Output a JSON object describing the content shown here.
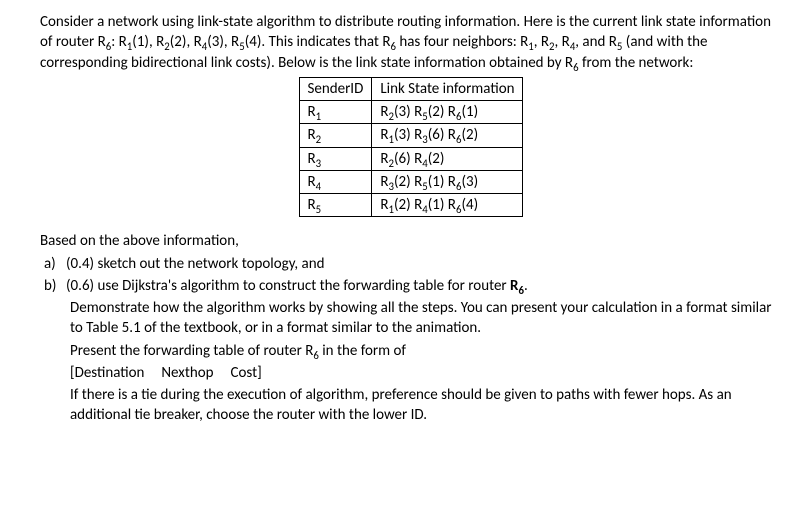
{
  "intro": {
    "line1_a": "Consider a network using link-state algorithm to distribute routing information. Here is the",
    "line2_a": "current link state information of router R",
    "line2_b": ": R",
    "line2_c": "(1), R",
    "line2_d": "(2), R",
    "line2_e": "(3), R",
    "line2_f": "(4). This indicates that R",
    "line2_g": " has",
    "line3_a": "four neighbors: R",
    "line3_b": ", R",
    "line3_c": ", R",
    "line3_d": ", and R",
    "line3_e": " (and with the corresponding bidirectional link costs). Below is",
    "line4_a": "the link state information obtained by R",
    "line4_b": " from the network:"
  },
  "table": {
    "headers": {
      "sender": "SenderID",
      "ls": "Link State information"
    },
    "rows": [
      {
        "sender_pre": "R",
        "sender_sub": "1",
        "ls_parts": [
          [
            "R",
            "2",
            "(3)  "
          ],
          [
            "R",
            "5",
            "(2)  "
          ],
          [
            "R",
            "6",
            "(1)"
          ]
        ]
      },
      {
        "sender_pre": "R",
        "sender_sub": "2",
        "ls_parts": [
          [
            "R",
            "1",
            "(3)  "
          ],
          [
            "R",
            "3",
            "(6)  "
          ],
          [
            "R",
            "6",
            "(2)"
          ]
        ]
      },
      {
        "sender_pre": "R",
        "sender_sub": "3",
        "ls_parts": [
          [
            "R",
            "2",
            "(6)  "
          ],
          [
            "R",
            "4",
            "(2)"
          ]
        ]
      },
      {
        "sender_pre": "R",
        "sender_sub": "4",
        "ls_parts": [
          [
            "R",
            "3",
            "(2)  "
          ],
          [
            "R",
            "5",
            "(1)  "
          ],
          [
            "R",
            "6",
            "(3)"
          ]
        ]
      },
      {
        "sender_pre": "R",
        "sender_sub": "5",
        "ls_parts": [
          [
            "R",
            "1",
            "(2)  "
          ],
          [
            "R",
            "4",
            "(1)  "
          ],
          [
            "R",
            "6",
            "(4)"
          ]
        ]
      }
    ]
  },
  "based": "Based on the above information,",
  "qa": {
    "label": "a)",
    "text": "(0.4) sketch out the network topology, and"
  },
  "qb": {
    "label": "b)",
    "text_a": "(0.6) use Dijkstra's algorithm to construct the forwarding table for router ",
    "text_b": "R",
    "text_c": "."
  },
  "para1": "Demonstrate how the algorithm works by showing all the steps. You can present your calculation in a format similar to Table 5.1 of the textbook, or in a format similar to the animation.",
  "para2_a": "Present the forwarding table of router R",
  "para2_b": " in the form of",
  "para3": "[Destination     Nexthop     Cost]",
  "para4": "If there is a tie during the execution of algorithm, preference should be given to paths with fewer hops. As an additional tie breaker, choose the router with the lower ID.",
  "subs": {
    "s1": "1",
    "s2": "2",
    "s3": "3",
    "s4": "4",
    "s5": "5",
    "s6": "6"
  }
}
